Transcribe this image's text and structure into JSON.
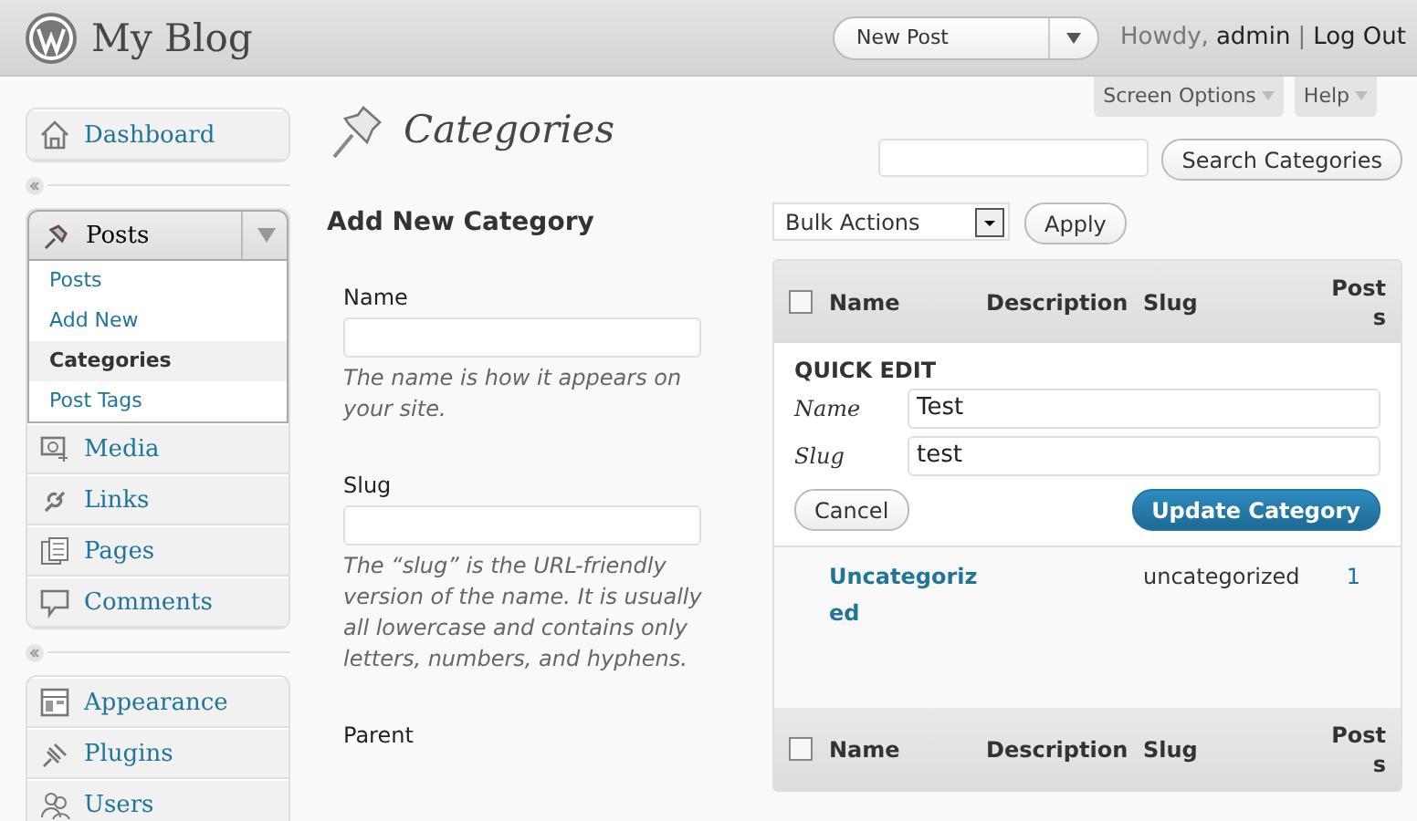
{
  "header": {
    "site_title": "My Blog",
    "new_post_button": "New Post",
    "greeting": "Howdy,",
    "user": "admin",
    "separator": "|",
    "logout": "Log Out"
  },
  "screen_tabs": [
    "Screen Options",
    "Help"
  ],
  "sidebar": {
    "groups": [
      [
        {
          "label": "Dashboard",
          "expanded": false
        }
      ],
      [
        {
          "label": "Posts",
          "expanded": true,
          "children": [
            {
              "label": "Posts",
              "selected": false
            },
            {
              "label": "Add New",
              "selected": false
            },
            {
              "label": "Categories",
              "selected": true
            },
            {
              "label": "Post Tags",
              "selected": false
            }
          ]
        },
        {
          "label": "Media",
          "expanded": false
        },
        {
          "label": "Links",
          "expanded": false
        },
        {
          "label": "Pages",
          "expanded": false
        },
        {
          "label": "Comments",
          "expanded": false
        }
      ],
      [
        {
          "label": "Appearance",
          "expanded": false
        },
        {
          "label": "Plugins",
          "expanded": false
        },
        {
          "label": "Users",
          "expanded": false
        }
      ]
    ]
  },
  "page_title": "Categories",
  "add_form": {
    "heading": "Add New Category",
    "fields": [
      {
        "label": "Name",
        "help": "The name is how it appears on your site."
      },
      {
        "label": "Slug",
        "help": "The “slug” is the URL-friendly version of the name. It is usually all lowercase and contains only letters, numbers, and hyphens."
      },
      {
        "label": "Parent"
      }
    ]
  },
  "search": {
    "button": "Search Categories"
  },
  "bulk": {
    "select": "Bulk Actions",
    "apply": "Apply"
  },
  "table": {
    "columns": [
      "Name",
      "Description",
      "Slug",
      "Posts"
    ],
    "header_checked": false,
    "quick_edit": {
      "title": "QUICK EDIT",
      "fields": [
        {
          "label": "Name",
          "value": "Test"
        },
        {
          "label": "Slug",
          "value": "test"
        }
      ],
      "cancel": "Cancel",
      "update": "Update Category"
    },
    "rows": [
      {
        "name": "Uncategorized",
        "slug": "uncategorized",
        "posts": "1"
      }
    ],
    "footer_columns": [
      "Name",
      "Description",
      "Slug",
      "Posts"
    ],
    "footer_checked": false
  }
}
